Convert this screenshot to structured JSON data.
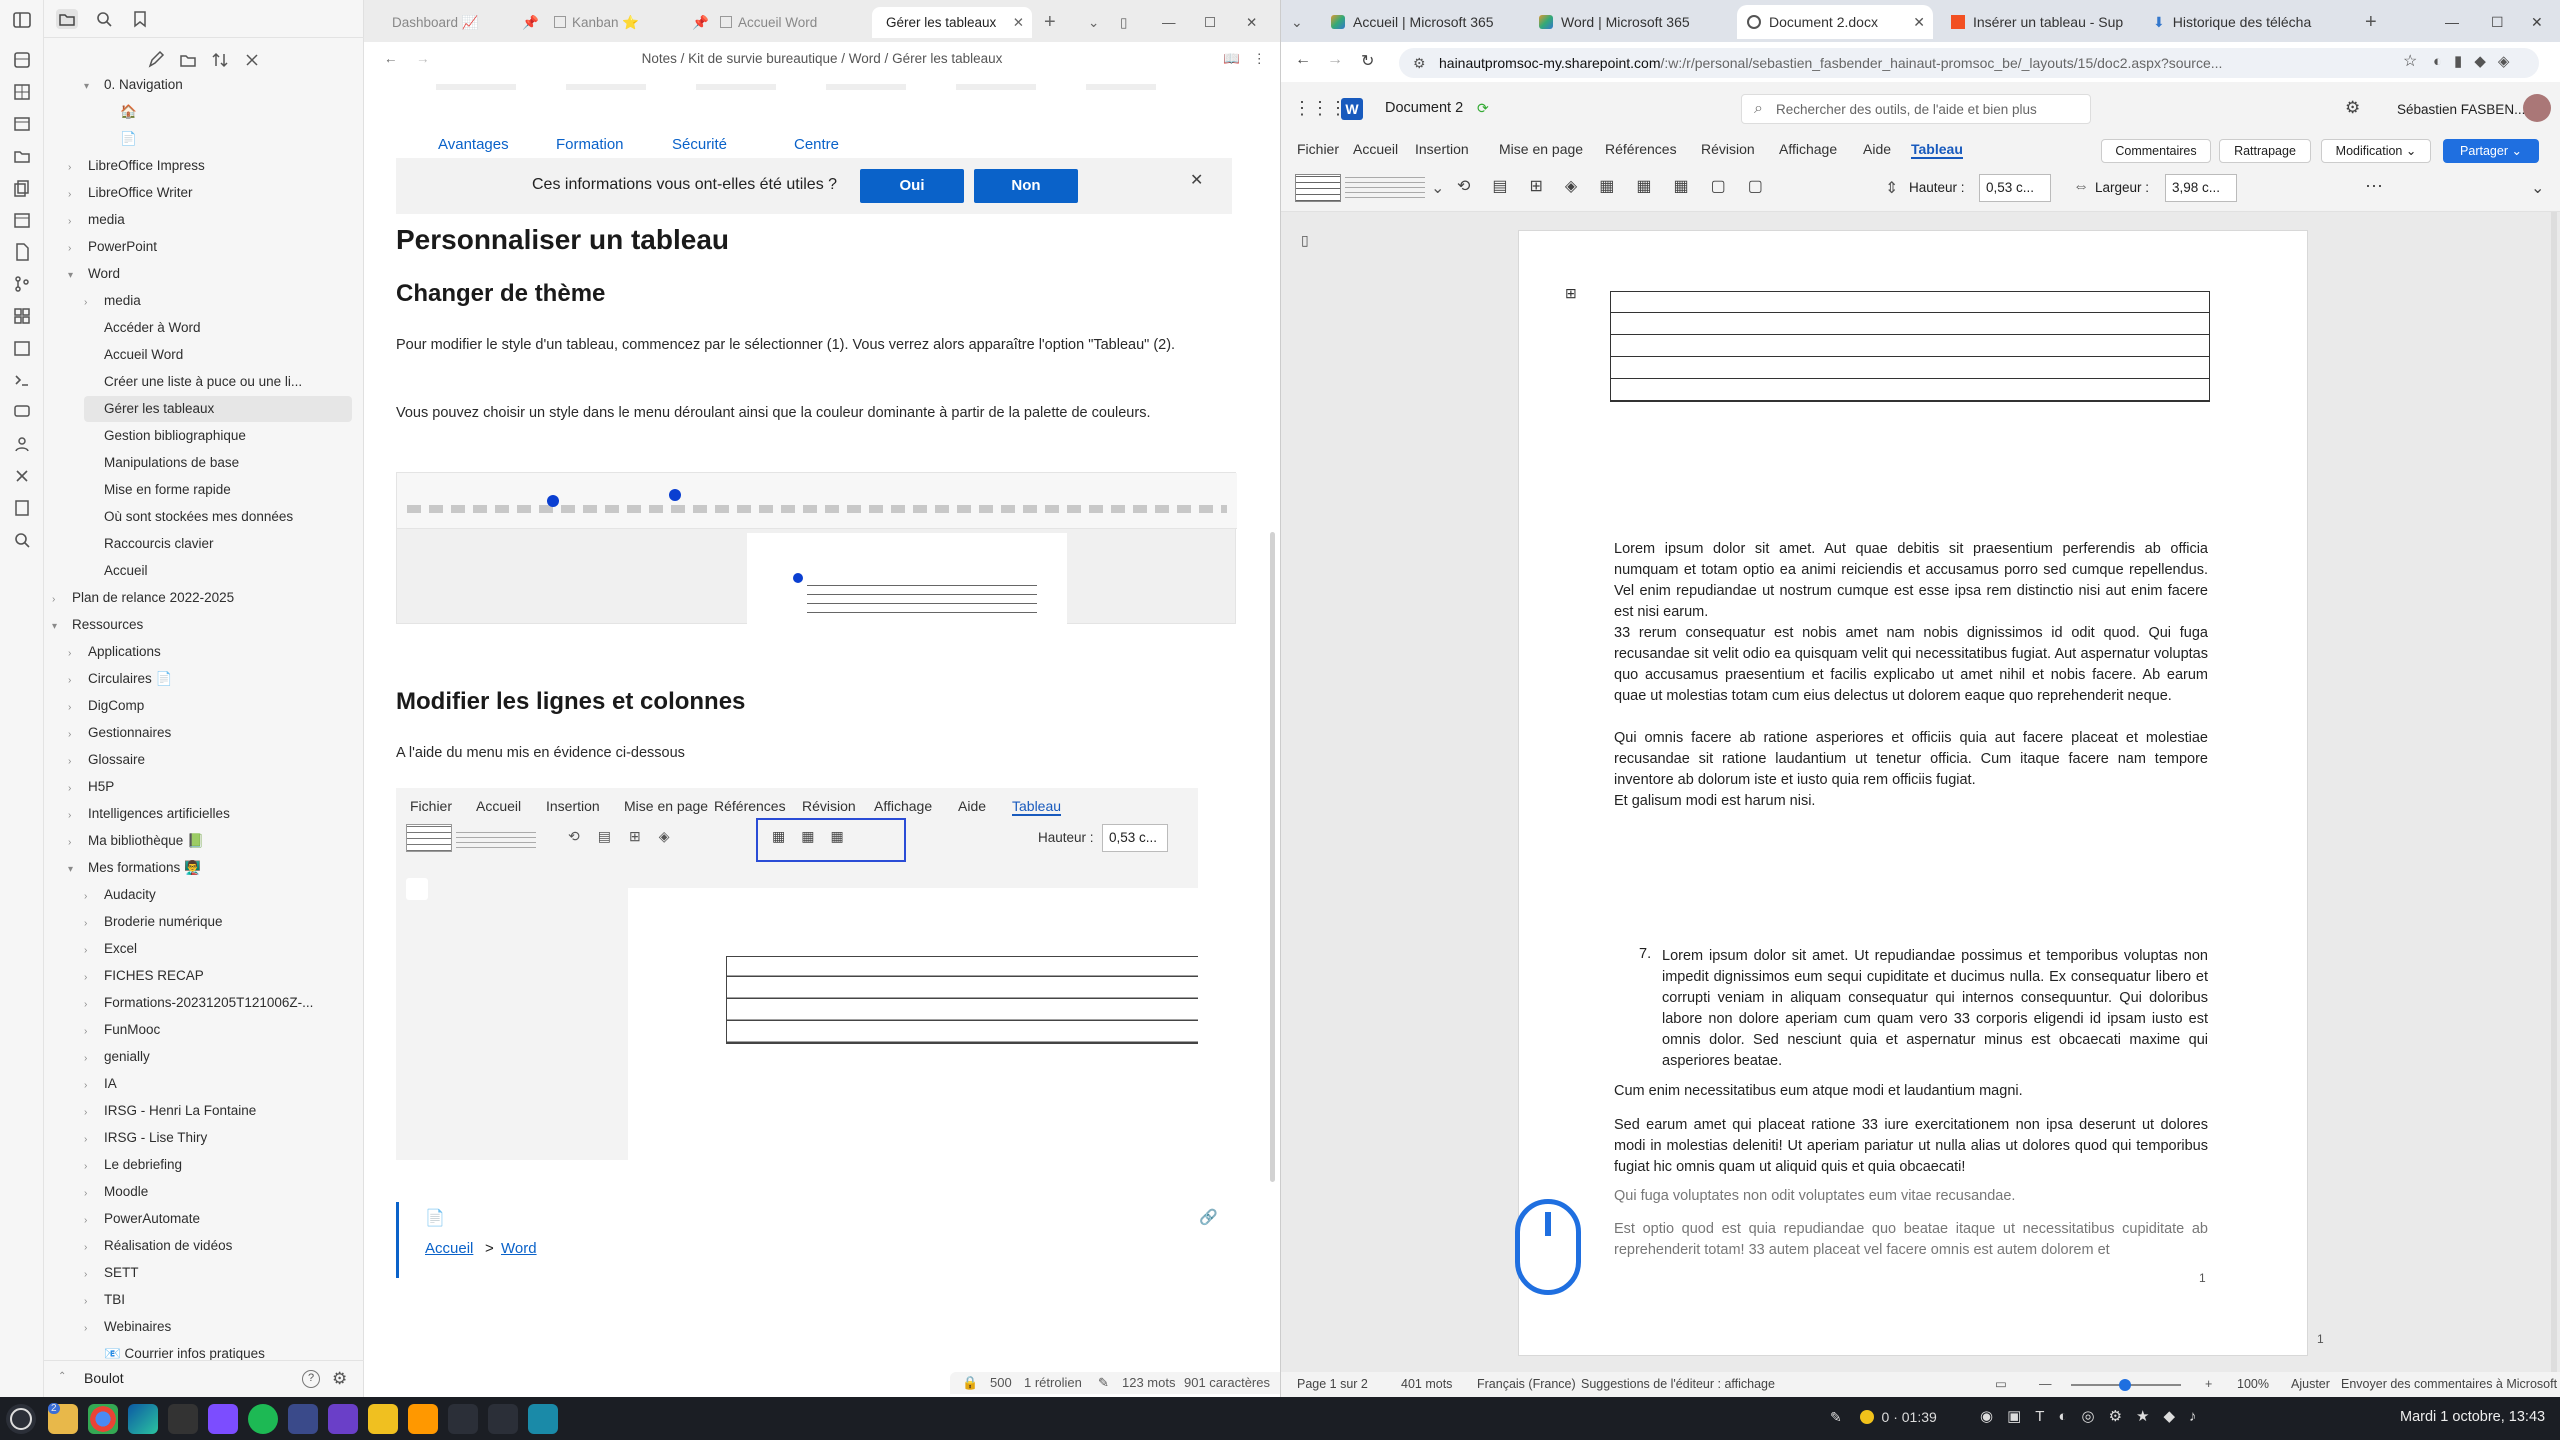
{
  "obsidian": {
    "vault_name": "Boulot",
    "tabs": [
      {
        "label": "Dashboard 📈"
      },
      {
        "label": "Kanban ⭐"
      },
      {
        "label": "Accueil Word"
      },
      {
        "label": "Gérer les tableaux"
      }
    ],
    "breadcrumb": [
      "Notes",
      "Kit de survie bureautique",
      "Word",
      "Gérer les tableaux"
    ],
    "tree": [
      {
        "label": "0. Navigation",
        "chev": "▾"
      },
      {
        "label": "🏠",
        "chev": ""
      },
      {
        "label": "📄",
        "chev": ""
      },
      {
        "label": "LibreOffice Impress",
        "chev": "›"
      },
      {
        "label": "LibreOffice Writer",
        "chev": "›"
      },
      {
        "label": "media",
        "chev": "›"
      },
      {
        "label": "PowerPoint",
        "chev": "›"
      },
      {
        "label": "Word",
        "chev": "▾"
      },
      {
        "label": "media",
        "chev": "›"
      },
      {
        "label": "Accéder à Word",
        "chev": ""
      },
      {
        "label": "Accueil Word",
        "chev": ""
      },
      {
        "label": "Créer une liste à puce ou une li...",
        "chev": ""
      },
      {
        "label": "Gérer les tableaux",
        "chev": ""
      },
      {
        "label": "Gestion bibliographique",
        "chev": ""
      },
      {
        "label": "Manipulations de base",
        "chev": ""
      },
      {
        "label": "Mise en forme rapide",
        "chev": ""
      },
      {
        "label": "Où sont stockées mes données",
        "chev": ""
      },
      {
        "label": "Raccourcis clavier",
        "chev": ""
      },
      {
        "label": "Accueil",
        "chev": ""
      },
      {
        "label": "Plan de relance 2022-2025",
        "chev": "›"
      },
      {
        "label": "Ressources",
        "chev": "▾"
      },
      {
        "label": "Applications",
        "chev": "›"
      },
      {
        "label": "Circulaires 📄",
        "chev": "›"
      },
      {
        "label": "DigComp",
        "chev": "›"
      },
      {
        "label": "Gestionnaires",
        "chev": "›"
      },
      {
        "label": "Glossaire",
        "chev": "›"
      },
      {
        "label": "H5P",
        "chev": "›"
      },
      {
        "label": "Intelligences artificielles",
        "chev": "›"
      },
      {
        "label": "Ma bibliothèque 📗",
        "chev": "›"
      },
      {
        "label": "Mes formations 👨‍🏫",
        "chev": "▾"
      },
      {
        "label": "Audacity",
        "chev": "›"
      },
      {
        "label": "Broderie numérique",
        "chev": "›"
      },
      {
        "label": "Excel",
        "chev": "›"
      },
      {
        "label": "FICHES RECAP",
        "chev": "›"
      },
      {
        "label": "Formations-20231205T121006Z-...",
        "chev": "›"
      },
      {
        "label": "FunMooc",
        "chev": "›"
      },
      {
        "label": "genially",
        "chev": "›"
      },
      {
        "label": "IA",
        "chev": "›"
      },
      {
        "label": "IRSG - Henri La Fontaine",
        "chev": "›"
      },
      {
        "label": "IRSG - Lise Thiry",
        "chev": "›"
      },
      {
        "label": "Le debriefing",
        "chev": "›"
      },
      {
        "label": "Moodle",
        "chev": "›"
      },
      {
        "label": "PowerAutomate",
        "chev": "›"
      },
      {
        "label": "Réalisation de vidéos",
        "chev": "›"
      },
      {
        "label": "SETT",
        "chev": "›"
      },
      {
        "label": "TBI",
        "chev": "›"
      },
      {
        "label": "Webinaires",
        "chev": "›"
      },
      {
        "label": "📧 Courrier infos pratiques",
        "chev": ""
      }
    ],
    "note": {
      "mini_nav": [
        "Avantages",
        "Formation",
        "Sécurité",
        "Centre"
      ],
      "feedback_question": "Ces informations vous ont-elles été utiles ?",
      "yes": "Oui",
      "no": "Non",
      "title": "Personnaliser un tableau",
      "h_theme": "Changer de thème",
      "p1": "Pour modifier le style d'un tableau, commencez par le sélectionner (1).  Vous verrez alors apparaître l'option \"Tableau\" (2).",
      "p2": "Vous pouvez choisir un style dans le menu déroulant ainsi que la couleur dominante à partir de la palette de couleurs.",
      "h_rows": "Modifier les lignes et colonnes",
      "p3": "A l'aide du menu mis en évidence ci-dessous",
      "shot_menu": [
        "Fichier",
        "Accueil",
        "Insertion",
        "Mise en page",
        "Références",
        "Révision",
        "Affichage",
        "Aide",
        "Tableau"
      ],
      "shot_height_label": "Hauteur :",
      "shot_height_val": "0,53 c...",
      "footer_link1": "Accueil",
      "footer_sep": ">",
      "footer_link2": "Word"
    },
    "status": {
      "count": "500",
      "backlinks": "1 rétrolien",
      "words": "123 mots",
      "chars": "901 caractères"
    }
  },
  "browser": {
    "tabs": [
      {
        "label": "Accueil | Microsoft 365"
      },
      {
        "label": "Word | Microsoft 365"
      },
      {
        "label": "Document 2.docx"
      },
      {
        "label": "Insérer un tableau - Sup"
      },
      {
        "label": "Historique des télécha"
      }
    ],
    "url_host": "hainautpromsoc-my.sharepoint.com",
    "url_path": "/:w:/r/personal/sebastien_fasbender_hainaut-promsoc_be/_layouts/15/doc2.aspx?source...",
    "word": {
      "doc_name": "Document 2",
      "search_placeholder": "Rechercher des outils, de l'aide et bien plus",
      "user": "Sébastien FASBEN...",
      "menu": [
        "Fichier",
        "Accueil",
        "Insertion",
        "Mise en page",
        "Références",
        "Révision",
        "Affichage",
        "Aide",
        "Tableau"
      ],
      "comments": "Commentaires",
      "catchup": "Rattrapage",
      "mode": "Modification",
      "share": "Partager",
      "height_label": "Hauteur :",
      "height_val": "0,53 c...",
      "width_label": "Largeur :",
      "width_val": "3,98 c...",
      "paragraphs": [
        "Lorem ipsum dolor sit amet. Aut quae debitis sit praesentium perferendis ab officia numquam et totam optio ea animi reiciendis et accusamus porro sed cumque repellendus. Vel enim repudiandae ut nostrum cumque est esse ipsa rem distinctio nisi aut enim facere est nisi earum.",
        "33 rerum consequatur est nobis amet nam nobis dignissimos id odit quod. Qui fuga recusandae sit velit odio ea quisquam velit qui necessitatibus fugiat. Aut aspernatur voluptas quo accusamus praesentium et facilis explicabo ut amet nihil et nobis facere. Ab earum quae ut molestias totam cum eius delectus ut dolorem eaque quo reprehenderit neque.",
        "Qui omnis facere ab ratione asperiores et officiis quia aut facere placeat et molestiae recusandae sit ratione laudantium ut tenetur officia. Cum itaque facere nam tempore inventore ab dolorum iste et iusto quia rem officiis fugiat.",
        "Et galisum modi est harum nisi."
      ],
      "list_num": "7.",
      "list_item": "Lorem ipsum dolor sit amet. Ut repudiandae possimus et temporibus voluptas non impedit dignissimos eum sequi cupiditate et ducimus nulla. Ex consequatur libero et corrupti veniam in aliquam consequatur qui internos consequuntur. Qui doloribus labore non dolore aperiam cum quam vero 33 corporis eligendi id ipsam iusto est omnis dolor. Sed nesciunt quia et aspernatur minus est obcaecati maxime qui asperiores beatae.",
      "p5": "Cum enim necessitatibus eum atque modi et laudantium magni.",
      "p6": "Sed earum amet qui placeat ratione 33 iure exercitationem non ipsa deserunt ut dolores modi in molestias deleniti! Ut aperiam pariatur ut nulla alias ut dolores quod qui temporibus fugiat hic omnis quam ut aliquid quis et quia obcaecati!",
      "p7": "Qui fuga voluptates non odit voluptates eum vitae recusandae.",
      "p8": "Est optio quod est quia repudiandae quo beatae itaque ut necessitatibus cupiditate ab reprehenderit totam! 33 autem placeat vel facere omnis est autem dolorem et",
      "page_num": "1",
      "page_num2": "1",
      "status": {
        "page": "Page 1 sur 2",
        "words": "401 mots",
        "lang": "Français (France)",
        "suggest": "Suggestions de l'éditeur : affichage",
        "zoom": "100%",
        "fit": "Ajuster",
        "feedback": "Envoyer des commentaires à Microsoft"
      }
    }
  },
  "taskbar": {
    "timer": "0 · 01:39",
    "clock": "Mardi 1 octobre, 13:43",
    "badge": "2"
  },
  "colors": {
    "accent_blue": "#0a62c9",
    "word_blue": "#185abd",
    "share_blue": "#1f6fe0",
    "taskbar": "#1b1e24"
  }
}
